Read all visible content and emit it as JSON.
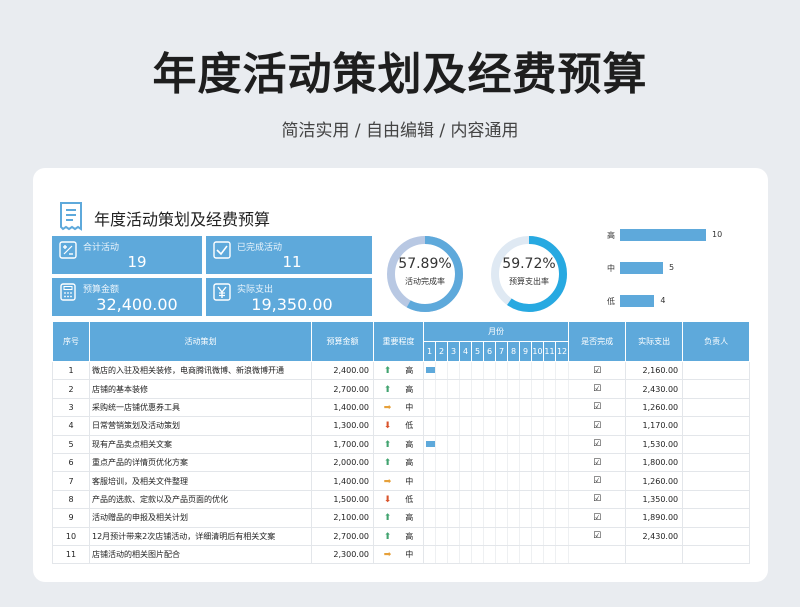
{
  "header": {
    "title": "年度活动策划及经费预算",
    "subtitle": "简洁实用 / 自由编辑 / 内容通用"
  },
  "sheet": {
    "title": "年度活动策划及经费预算",
    "kpis": {
      "total_label": "合计活动",
      "total_value": "19",
      "done_label": "已完成活动",
      "done_value": "11",
      "budget_label": "预算金额",
      "budget_value": "32,400.00",
      "actual_label": "实际支出",
      "actual_value": "19,350.00"
    },
    "donuts": [
      {
        "pct": "57.89%",
        "caption": "活动完成率",
        "value": 0.5789,
        "color": "#5ea9db",
        "track": "#b8c8e3"
      },
      {
        "pct": "59.72%",
        "caption": "预算支出率",
        "value": 0.5972,
        "color": "#27a9e1",
        "track": "#dfe9f3"
      }
    ],
    "importance_chart": {
      "type": "bar",
      "categories": [
        "高",
        "中",
        "低"
      ],
      "values": [
        10,
        5,
        4
      ],
      "color": "#5ea9db"
    },
    "table": {
      "headers": {
        "no": "序号",
        "task": "活动策划",
        "budget": "预算金额",
        "importance": "重要程度",
        "month": "月份",
        "done": "是否完成",
        "actual": "实际支出",
        "owner": "负责人"
      },
      "months": [
        "1",
        "2",
        "3",
        "4",
        "5",
        "6",
        "7",
        "8",
        "9",
        "10",
        "11",
        "12"
      ],
      "rows": [
        {
          "no": "1",
          "task": "微店的入驻及相关装修，电商腾讯微博、新浪微博开通",
          "budget": "2,400.00",
          "arrow": "up",
          "level": "高",
          "start": 1,
          "end": 7,
          "done": "☑",
          "actual": "2,160.00"
        },
        {
          "no": "2",
          "task": "店铺的基本装修",
          "budget": "2,700.00",
          "arrow": "up",
          "level": "高",
          "start": 3,
          "end": 9,
          "done": "☑",
          "actual": "2,430.00"
        },
        {
          "no": "3",
          "task": "采购统一店铺优惠券工具",
          "budget": "1,400.00",
          "arrow": "side",
          "level": "中",
          "start": 6,
          "end": 12,
          "done": "☑",
          "actual": "1,260.00"
        },
        {
          "no": "4",
          "task": "日常营销策划及活动策划",
          "budget": "1,300.00",
          "arrow": "down",
          "level": "低",
          "start": 2,
          "end": 8,
          "done": "☑",
          "actual": "1,170.00"
        },
        {
          "no": "5",
          "task": "现有产品卖点相关文案",
          "budget": "1,700.00",
          "arrow": "up",
          "level": "高",
          "start": 1,
          "end": 10,
          "done": "☑",
          "actual": "1,530.00"
        },
        {
          "no": "6",
          "task": "重点产品的详情页优化方案",
          "budget": "2,000.00",
          "arrow": "up",
          "level": "高",
          "start": 3,
          "end": 12,
          "done": "☑",
          "actual": "1,800.00"
        },
        {
          "no": "7",
          "task": "客服培训，及相关文件整理",
          "budget": "1,400.00",
          "arrow": "side",
          "level": "中",
          "start": 6,
          "end": 12,
          "done": "☑",
          "actual": "1,260.00"
        },
        {
          "no": "8",
          "task": "产品的选款、定款以及产品页面的优化",
          "budget": "1,500.00",
          "arrow": "down",
          "level": "低",
          "start": 3,
          "end": 12,
          "done": "☑",
          "actual": "1,350.00"
        },
        {
          "no": "9",
          "task": "活动赠品的申报及相关计划",
          "budget": "2,100.00",
          "arrow": "up",
          "level": "高",
          "start": 3,
          "end": 9,
          "done": "☑",
          "actual": "1,890.00"
        },
        {
          "no": "10",
          "task": "12月预计带来2次店铺活动，详细清明后有相关文案",
          "budget": "2,700.00",
          "arrow": "up",
          "level": "高",
          "start": 0,
          "end": 0,
          "done": "☑",
          "actual": "2,430.00"
        },
        {
          "no": "11",
          "task": "店铺活动的相关图片配合",
          "budget": "2,300.00",
          "arrow": "side",
          "level": "中",
          "start": 0,
          "end": 0,
          "done": "",
          "actual": ""
        }
      ]
    },
    "colors": {
      "accent": "#5ea9db",
      "up": "#41a36f",
      "down": "#d9542c",
      "side": "#e6a03a"
    }
  }
}
